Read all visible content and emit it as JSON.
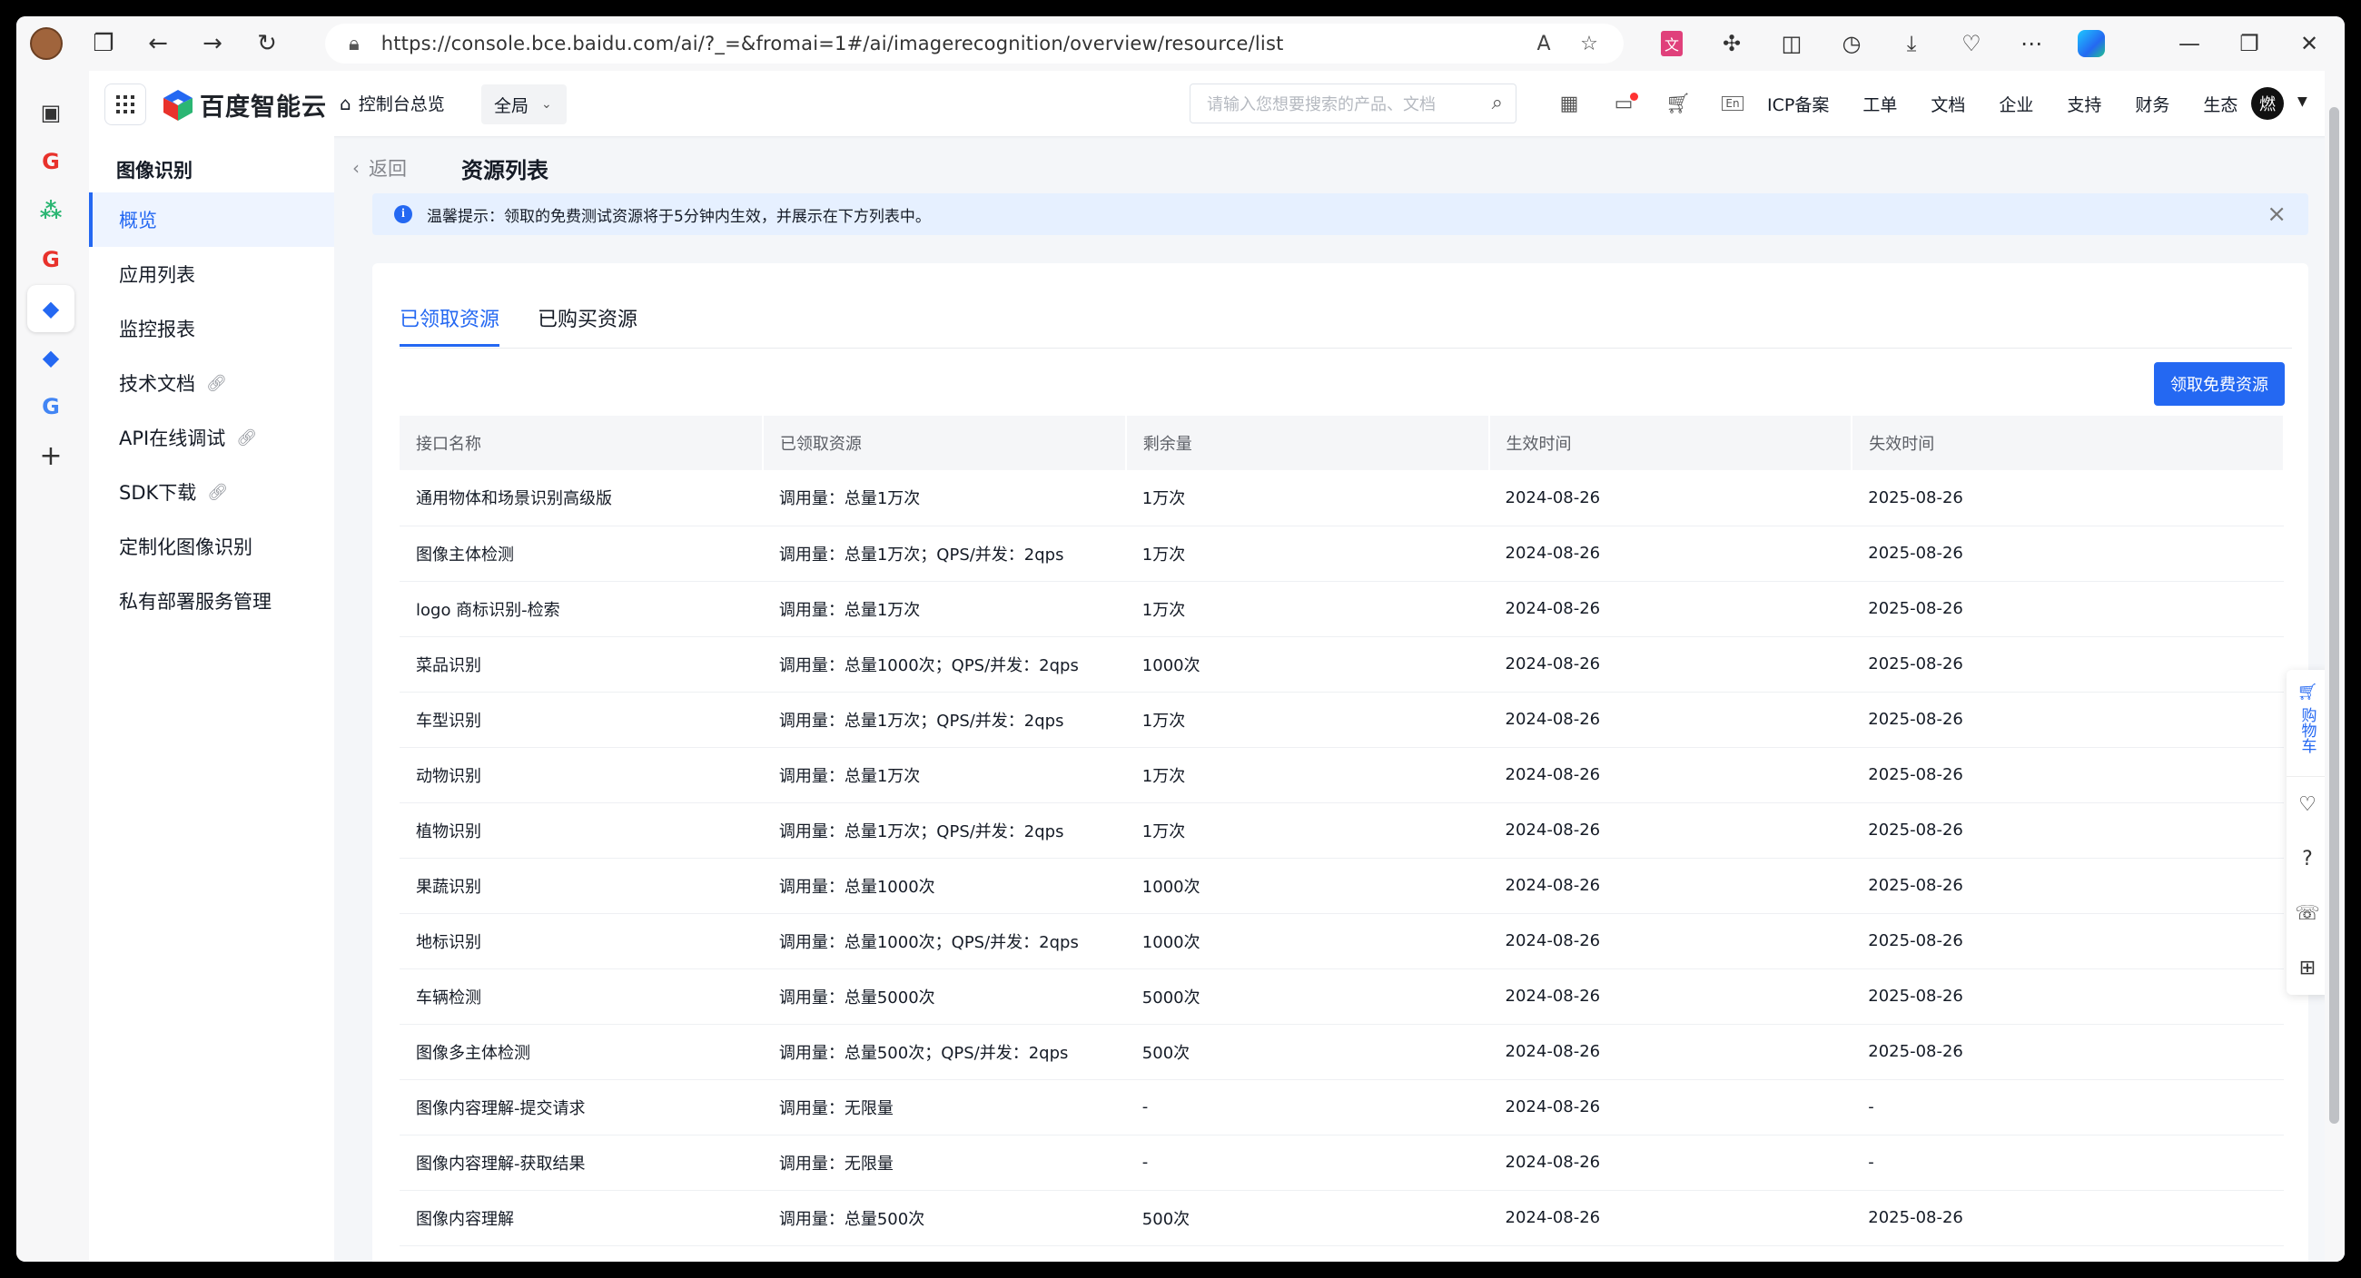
{
  "browser": {
    "url": "https://console.bce.baidu.com/ai/?_=&fromai=1#/ai/imagerecognition/overview/resource/list"
  },
  "topnav": {
    "brand": "百度智能云",
    "home": "控制台总览",
    "region": "全局",
    "search_placeholder": "请输入您想要搜索的产品、文档",
    "links": [
      "ICP备案",
      "工单",
      "文档",
      "企业",
      "支持",
      "财务",
      "生态"
    ],
    "user_initial": "燃"
  },
  "sidebar": {
    "title": "图像识别",
    "items": [
      "概览",
      "应用列表",
      "监控报表",
      "技术文档",
      "API在线调试",
      "SDK下载",
      "定制化图像识别",
      "私有部署服务管理"
    ]
  },
  "header": {
    "back": "返回",
    "title": "资源列表"
  },
  "alert": {
    "text": "温馨提示：领取的免费测试资源将于5分钟内生效，并展示在下方列表中。"
  },
  "tabs": [
    "已领取资源",
    "已购买资源"
  ],
  "claim_button": "领取免费资源",
  "table": {
    "columns": [
      "接口名称",
      "已领取资源",
      "剩余量",
      "生效时间",
      "失效时间"
    ],
    "rows": [
      [
        "通用物体和场景识别高级版",
        "调用量：总量1万次",
        "1万次",
        "2024-08-26",
        "2025-08-26"
      ],
      [
        "图像主体检测",
        "调用量：总量1万次；QPS/并发：2qps",
        "1万次",
        "2024-08-26",
        "2025-08-26"
      ],
      [
        "logo 商标识别-检索",
        "调用量：总量1万次",
        "1万次",
        "2024-08-26",
        "2025-08-26"
      ],
      [
        "菜品识别",
        "调用量：总量1000次；QPS/并发：2qps",
        "1000次",
        "2024-08-26",
        "2025-08-26"
      ],
      [
        "车型识别",
        "调用量：总量1万次；QPS/并发：2qps",
        "1万次",
        "2024-08-26",
        "2025-08-26"
      ],
      [
        "动物识别",
        "调用量：总量1万次",
        "1万次",
        "2024-08-26",
        "2025-08-26"
      ],
      [
        "植物识别",
        "调用量：总量1万次；QPS/并发：2qps",
        "1万次",
        "2024-08-26",
        "2025-08-26"
      ],
      [
        "果蔬识别",
        "调用量：总量1000次",
        "1000次",
        "2024-08-26",
        "2025-08-26"
      ],
      [
        "地标识别",
        "调用量：总量1000次；QPS/并发：2qps",
        "1000次",
        "2024-08-26",
        "2025-08-26"
      ],
      [
        "车辆检测",
        "调用量：总量5000次",
        "5000次",
        "2024-08-26",
        "2025-08-26"
      ],
      [
        "图像多主体检测",
        "调用量：总量500次；QPS/并发：2qps",
        "500次",
        "2024-08-26",
        "2025-08-26"
      ],
      [
        "图像内容理解-提交请求",
        "调用量：无限量",
        "-",
        "2024-08-26",
        "-"
      ],
      [
        "图像内容理解-获取结果",
        "调用量：无限量",
        "-",
        "2024-08-26",
        "-"
      ],
      [
        "图像内容理解",
        "调用量：总量500次",
        "500次",
        "2024-08-26",
        "2025-08-26"
      ]
    ]
  },
  "float_tools": {
    "cart": "购物车"
  },
  "colors": {
    "accent": "#2468f2",
    "alert_bg": "#e6f0ff",
    "sidebar_active_bg": "#eef4ff"
  }
}
